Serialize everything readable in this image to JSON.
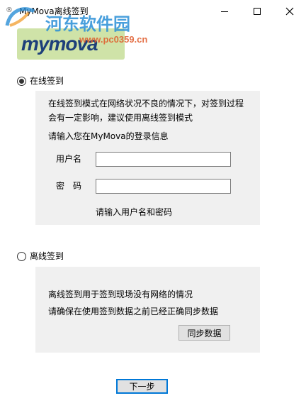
{
  "window": {
    "title": "MyMova离线签到"
  },
  "watermark": {
    "main": "河东软件园",
    "url": "www.pc0359.cn"
  },
  "logo": {
    "text": "mymova"
  },
  "online": {
    "radio_label": "在线签到",
    "selected": true,
    "desc_line1": "在线签到模式在网络状况不良的情况下，对签到过程",
    "desc_line2": "会有一定影响，建议使用离线签到模式",
    "prompt": "请输入您在MyMova的登录信息",
    "username_label": "用户名",
    "username_value": "",
    "password_label": "密　码",
    "password_value": "",
    "hint": "请输入用户名和密码"
  },
  "offline": {
    "radio_label": "离线签到",
    "selected": false,
    "desc_line1": "离线签到用于签到现场没有网络的情况",
    "desc_line2": "请确保在使用签到数据之前已经正确同步数据",
    "sync_button": "同步数据"
  },
  "footer": {
    "next_button": "下一步"
  }
}
